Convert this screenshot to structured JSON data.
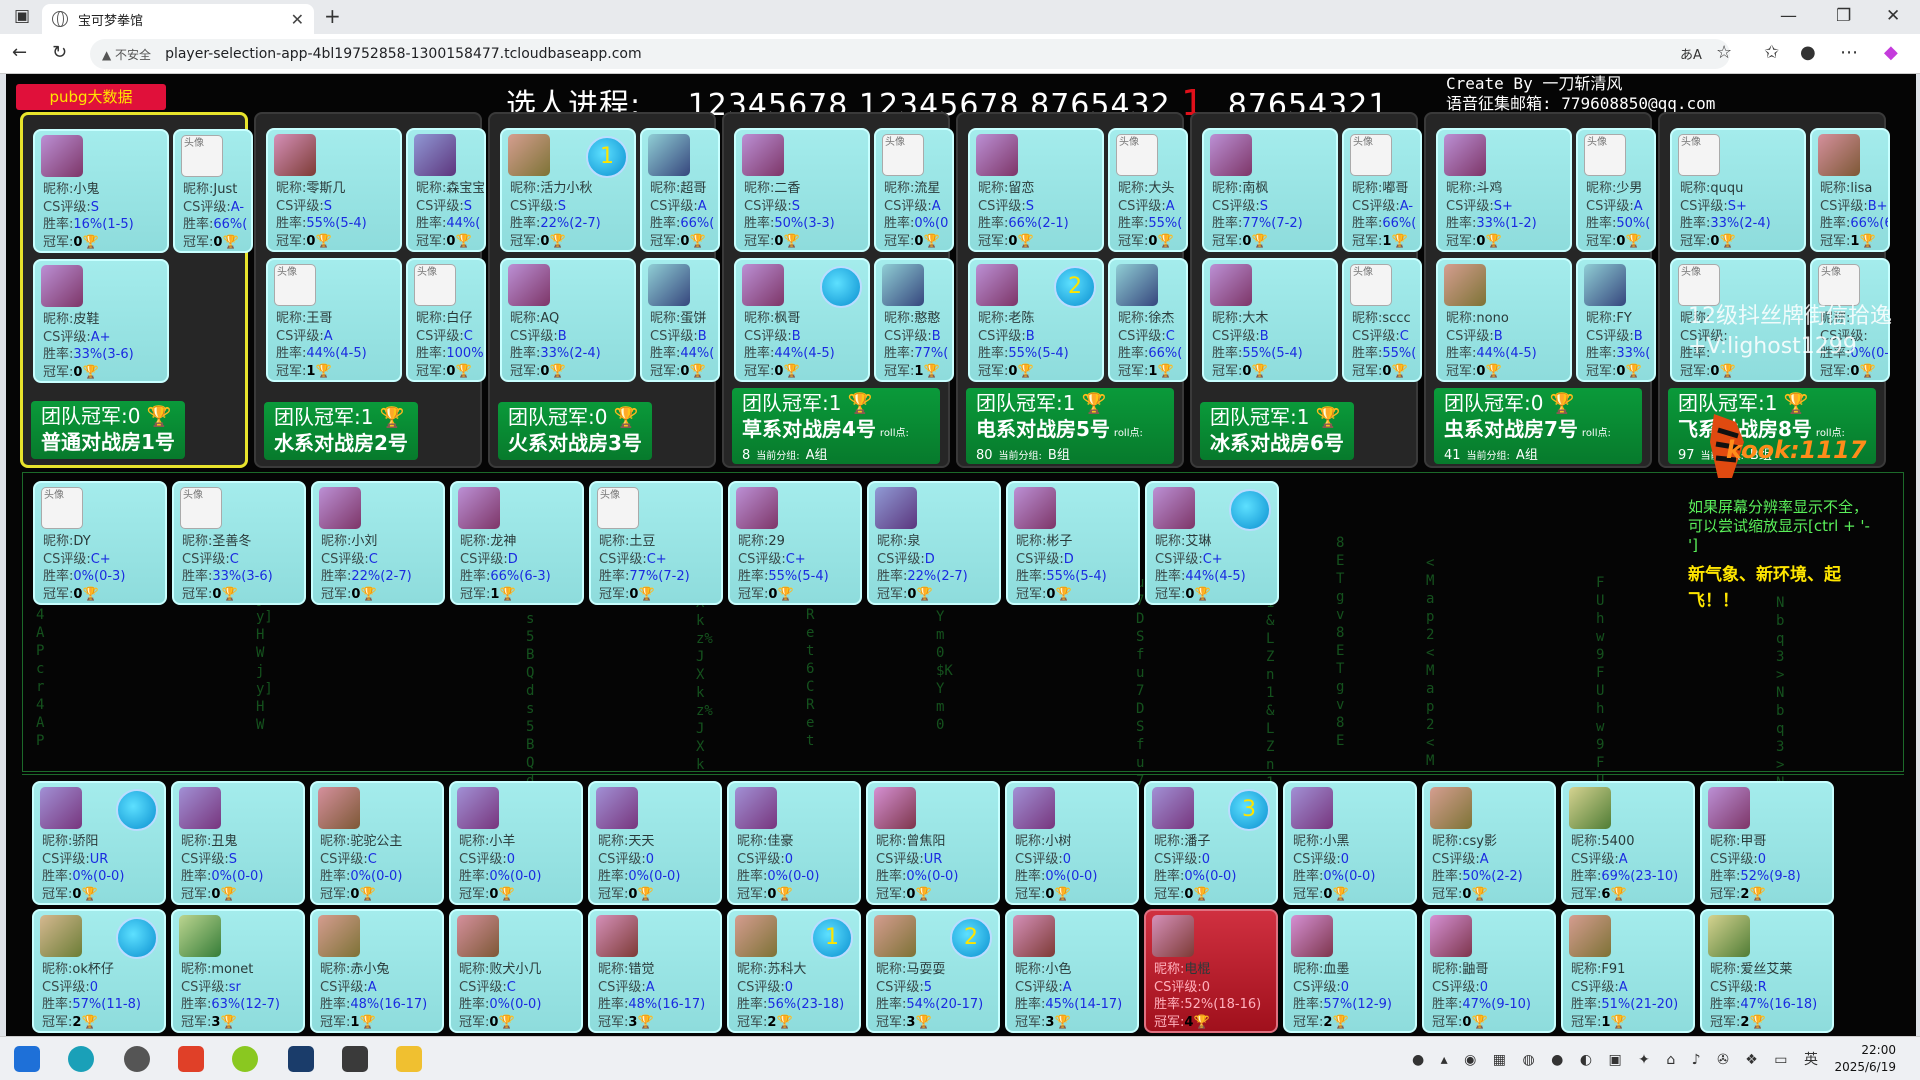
{
  "browser": {
    "tab_title": "宝可梦拳馆",
    "insecure_label": "不安全",
    "url": "player-selection-app-4bl19752858-1300158477.tcloudbaseapp.com"
  },
  "header": {
    "pubg_button": "pubg大数据",
    "progress_label": "选人进程:",
    "progress_value_a": "12345678 12345678 8765432",
    "progress_red": "1",
    "progress_value_b": "87654321",
    "credit_line1": "Create By 一刀斩清风",
    "credit_line2": "语音征集邮箱: 779608850@qq.com"
  },
  "labels": {
    "nick": "昵称:",
    "cs": "CS评级:",
    "rate": "胜率:",
    "champ": "冠军:",
    "team_champ": "团队冠军:",
    "roll": "roll点:",
    "current_group": "当前分组:",
    "avatar_placeholder": "头像"
  },
  "rooms": [
    {
      "name": "普通对战房1号",
      "team_champ": "0",
      "selected": true,
      "players": [
        {
          "nick": "小鬼",
          "cs": "S",
          "rate": "16%(1-5)",
          "champ": "0"
        },
        {
          "nick": "Just",
          "cs": "A-",
          "rate": "66%(",
          "champ": "0"
        },
        {
          "nick": "皮鞋",
          "cs": "A+",
          "rate": "33%(3-6)",
          "champ": "0"
        }
      ]
    },
    {
      "name": "水系对战房2号",
      "team_champ": "1",
      "players": [
        {
          "nick": "零斯几",
          "cs": "S",
          "rate": "55%(5-4)",
          "champ": "0"
        },
        {
          "nick": "森宝宝",
          "cs": "S",
          "rate": "44%(",
          "champ": "0"
        },
        {
          "nick": "王哥",
          "cs": "A",
          "rate": "44%(4-5)",
          "champ": "1"
        },
        {
          "nick": "白仔",
          "cs": "C",
          "rate": "100%",
          "champ": "0"
        }
      ]
    },
    {
      "name": "火系对战房3号",
      "team_champ": "0",
      "players": [
        {
          "nick": "活力小秋",
          "cs": "S",
          "rate": "22%(2-7)",
          "champ": "0",
          "speaker": "1"
        },
        {
          "nick": "超哥",
          "cs": "A",
          "rate": "66%(",
          "champ": "0"
        },
        {
          "nick": "AQ",
          "cs": "B",
          "rate": "33%(2-4)",
          "champ": "0"
        },
        {
          "nick": "蛋饼",
          "cs": "B",
          "rate": "44%(",
          "champ": "0"
        }
      ]
    },
    {
      "name": "草系对战房4号",
      "team_champ": "1",
      "roll": "8",
      "group": "A组",
      "players": [
        {
          "nick": "二香",
          "cs": "S",
          "rate": "50%(3-3)",
          "champ": "0"
        },
        {
          "nick": "流星",
          "cs": "A",
          "rate": "0%(0",
          "champ": "0"
        },
        {
          "nick": "枫哥",
          "cs": "B",
          "rate": "44%(4-5)",
          "champ": "0",
          "speaker": ""
        },
        {
          "nick": "憨憨",
          "cs": "B",
          "rate": "77%(",
          "champ": "1"
        }
      ]
    },
    {
      "name": "电系对战房5号",
      "team_champ": "1",
      "roll": "80",
      "group": "B组",
      "players": [
        {
          "nick": "留恋",
          "cs": "S",
          "rate": "66%(2-1)",
          "champ": "0"
        },
        {
          "nick": "大头",
          "cs": "A",
          "rate": "55%(",
          "champ": "0"
        },
        {
          "nick": "老陈",
          "cs": "B",
          "rate": "55%(5-4)",
          "champ": "0",
          "speaker": "2"
        },
        {
          "nick": "徐杰",
          "cs": "C",
          "rate": "66%(",
          "champ": "1"
        }
      ]
    },
    {
      "name": "冰系对战房6号",
      "team_champ": "1",
      "players": [
        {
          "nick": "南枫",
          "cs": "S",
          "rate": "77%(7-2)",
          "champ": "0"
        },
        {
          "nick": "嘟哥",
          "cs": "A-",
          "rate": "66%(",
          "champ": "1"
        },
        {
          "nick": "大木",
          "cs": "B",
          "rate": "55%(5-4)",
          "champ": "0"
        },
        {
          "nick": "sccc",
          "cs": "C",
          "rate": "55%(",
          "champ": "0"
        }
      ]
    },
    {
      "name": "虫系对战房7号",
      "team_champ": "0",
      "roll": "41",
      "group": "A组",
      "players": [
        {
          "nick": "斗鸡",
          "cs": "S+",
          "rate": "33%(1-2)",
          "champ": "0"
        },
        {
          "nick": "少男",
          "cs": "A",
          "rate": "50%(",
          "champ": "0"
        },
        {
          "nick": "nono",
          "cs": "B",
          "rate": "44%(4-5)",
          "champ": "0"
        },
        {
          "nick": "FY",
          "cs": "B",
          "rate": "33%(",
          "champ": "0"
        }
      ]
    },
    {
      "name": "飞系对战房8号",
      "team_champ": "1",
      "roll": "97",
      "group": "B组",
      "players": [
        {
          "nick": "ququ",
          "cs": "S+",
          "rate": "33%(2-4)",
          "champ": "0"
        },
        {
          "nick": "lisa",
          "cs": "B+",
          "rate": "66%(6-3",
          "champ": "1"
        },
        {
          "nick": "",
          "cs": "",
          "rate": "",
          "champ": "0"
        },
        {
          "nick": "",
          "cs": "",
          "rate": "0%(0-3)",
          "champ": "0"
        }
      ]
    }
  ],
  "lobby": [
    {
      "nick": "DY",
      "cs": "C+",
      "rate": "0%(0-3)",
      "champ": "0"
    },
    {
      "nick": "圣善冬",
      "cs": "C",
      "rate": "33%(3-6)",
      "champ": "0"
    },
    {
      "nick": "小刘",
      "cs": "C",
      "rate": "22%(2-7)",
      "champ": "0"
    },
    {
      "nick": "龙神",
      "cs": "D",
      "rate": "66%(6-3)",
      "champ": "1"
    },
    {
      "nick": "土豆",
      "cs": "C+",
      "rate": "77%(7-2)",
      "champ": "0"
    },
    {
      "nick": "29",
      "cs": "C+",
      "rate": "55%(5-4)",
      "champ": "0"
    },
    {
      "nick": "泉",
      "cs": "D",
      "rate": "22%(2-7)",
      "champ": "0"
    },
    {
      "nick": "彬子",
      "cs": "D",
      "rate": "55%(5-4)",
      "champ": "0"
    },
    {
      "nick": "艾琳",
      "cs": "C+",
      "rate": "44%(4-5)",
      "champ": "0",
      "speaker": ""
    }
  ],
  "pool_row1": [
    {
      "nick": "骄阳",
      "cs": "UR",
      "rate": "0%(0-0)",
      "champ": "0",
      "speaker": ""
    },
    {
      "nick": "丑鬼",
      "cs": "S",
      "rate": "0%(0-0)",
      "champ": "0"
    },
    {
      "nick": "驼驼公主",
      "cs": "C",
      "rate": "0%(0-0)",
      "champ": "0"
    },
    {
      "nick": "小羊",
      "cs": "0",
      "rate": "0%(0-0)",
      "champ": "0"
    },
    {
      "nick": "天天",
      "cs": "0",
      "rate": "0%(0-0)",
      "champ": "0"
    },
    {
      "nick": "佳豪",
      "cs": "0",
      "rate": "0%(0-0)",
      "champ": "0"
    },
    {
      "nick": "曾焦阳",
      "cs": "UR",
      "rate": "0%(0-0)",
      "champ": "0"
    },
    {
      "nick": "小树",
      "cs": "0",
      "rate": "0%(0-0)",
      "champ": "0"
    },
    {
      "nick": "潘子",
      "cs": "0",
      "rate": "0%(0-0)",
      "champ": "0",
      "speaker": "3"
    },
    {
      "nick": "小黑",
      "cs": "0",
      "rate": "0%(0-0)",
      "champ": "0"
    },
    {
      "nick": "csy影",
      "cs": "A",
      "rate": "50%(2-2)",
      "champ": "0"
    },
    {
      "nick": "5400",
      "cs": "A",
      "rate": "69%(23-10)",
      "champ": "6"
    },
    {
      "nick": "甲哥",
      "cs": "0",
      "rate": "52%(9-8)",
      "champ": "2"
    }
  ],
  "pool_row2": [
    {
      "nick": "ok杯仔",
      "cs": "0",
      "rate": "57%(11-8)",
      "champ": "2",
      "speaker": ""
    },
    {
      "nick": "monet",
      "cs": "sr",
      "rate": "63%(12-7)",
      "champ": "3"
    },
    {
      "nick": "赤小兔",
      "cs": "A",
      "rate": "48%(16-17)",
      "champ": "1"
    },
    {
      "nick": "败犬小几",
      "cs": "C",
      "rate": "0%(0-0)",
      "champ": "0"
    },
    {
      "nick": "错觉",
      "cs": "A",
      "rate": "48%(16-17)",
      "champ": "3"
    },
    {
      "nick": "苏科大",
      "cs": "0",
      "rate": "56%(23-18)",
      "champ": "2",
      "speaker": "1"
    },
    {
      "nick": "马耍耍",
      "cs": "5",
      "rate": "54%(20-17)",
      "champ": "3",
      "speaker": "2"
    },
    {
      "nick": "小色",
      "cs": "A",
      "rate": "45%(14-17)",
      "champ": "3"
    },
    {
      "nick": "电棍",
      "cs": "0",
      "rate": "52%(18-16)",
      "champ": "4",
      "red": true
    },
    {
      "nick": "血墨",
      "cs": "0",
      "rate": "57%(12-9)",
      "champ": "2"
    },
    {
      "nick": "鼬哥",
      "cs": "0",
      "rate": "47%(9-10)",
      "champ": "0"
    },
    {
      "nick": "F91",
      "cs": "A",
      "rate": "51%(21-20)",
      "champ": "1"
    },
    {
      "nick": "爱丝艾莱",
      "cs": "R",
      "rate": "47%(16-18)",
      "champ": "2"
    }
  ],
  "side": {
    "watermark_1": "12级抖丝牌街信拾逸",
    "watermark_2": "+V:lighost1299",
    "kook": "kook:1117",
    "notice": "如果屏幕分辨率显示不全，可以尝试缩放显示[ctrl + '-']",
    "slogan": "新气象、新环境、起飞！！"
  },
  "taskbar": {
    "time": "22:00",
    "date": "2025/6/19",
    "ime": "英"
  },
  "colors": {
    "card": "#9ce6e6",
    "room_label": "#0a9a3a",
    "selected_border": "#e8e42c",
    "highlight_red": "#c02030"
  }
}
